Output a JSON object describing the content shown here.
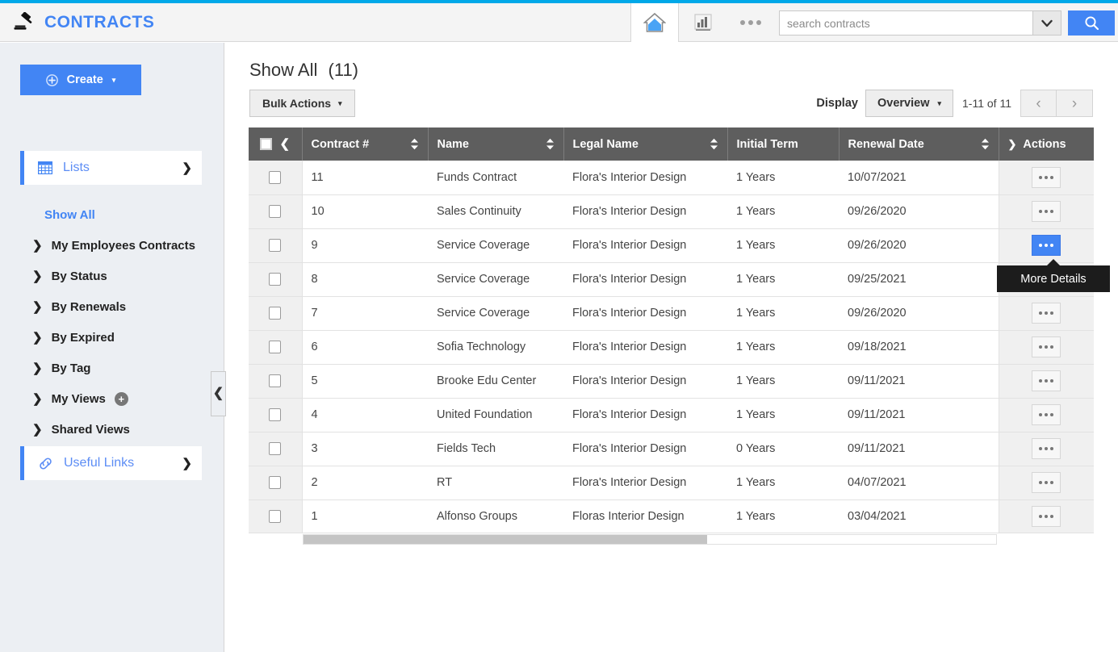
{
  "header": {
    "brand_title": "CONTRACTS",
    "brand_icon": "gavel-icon",
    "home_icon": "home-icon",
    "chart_icon": "bar-chart-icon",
    "more_icon": "ellipsis-icon",
    "search_placeholder": "search contracts",
    "search_value": "",
    "search_dropdown_icon": "chevron-down-icon",
    "search_button_icon": "search-icon"
  },
  "sidebar": {
    "create_label": "Create",
    "create_icon": "plus-circle-icon",
    "create_caret": "▾",
    "groups": [
      {
        "label": "Lists",
        "icon": "grid-icon",
        "chevron": "⌄"
      },
      {
        "label": "Useful Links",
        "icon": "link-icon",
        "chevron": "❯"
      }
    ],
    "items": [
      {
        "label": "Show All",
        "arrow": "",
        "active": true
      },
      {
        "label": "My Employees Contracts",
        "arrow": "❯",
        "active": false
      },
      {
        "label": "By Status",
        "arrow": "❯",
        "active": false
      },
      {
        "label": "By Renewals",
        "arrow": "❯",
        "active": false
      },
      {
        "label": "By Expired",
        "arrow": "❯",
        "active": false
      },
      {
        "label": "By Tag",
        "arrow": "❯",
        "active": false
      },
      {
        "label": "My Views",
        "arrow": "❯",
        "active": false,
        "add_badge": "+"
      },
      {
        "label": "Shared Views",
        "arrow": "❯",
        "active": false
      }
    ],
    "collapse_icon": "❮"
  },
  "main": {
    "title": "Show All",
    "count": "(11)",
    "bulk_actions_label": "Bulk Actions",
    "bulk_actions_caret": "▾",
    "display_label": "Display",
    "display_value": "Overview",
    "display_caret": "▾",
    "range_text": "1-11 of 11",
    "prev_icon": "‹",
    "next_icon": "›"
  },
  "table": {
    "columns": [
      {
        "key": "check",
        "label": "",
        "sortable": false
      },
      {
        "key": "number",
        "label": "Contract #",
        "sortable": true
      },
      {
        "key": "name",
        "label": "Name",
        "sortable": true
      },
      {
        "key": "legal",
        "label": "Legal Name",
        "sortable": true
      },
      {
        "key": "term",
        "label": "Initial Term",
        "sortable": false
      },
      {
        "key": "renew",
        "label": "Renewal Date",
        "sortable": true
      },
      {
        "key": "actions",
        "label": "Actions",
        "sortable": false
      }
    ],
    "header_collapse_icon": "❮",
    "actions_expand_icon": "❯",
    "row_action_icon": "ellipsis-icon",
    "rows": [
      {
        "number": "11",
        "name": "Funds Contract",
        "legal": "Flora's Interior Design",
        "term": "1 Years",
        "renew": "10/07/2021",
        "active": false
      },
      {
        "number": "10",
        "name": "Sales Continuity",
        "legal": "Flora's Interior Design",
        "term": "1 Years",
        "renew": "09/26/2020",
        "active": false
      },
      {
        "number": "9",
        "name": "Service Coverage",
        "legal": "Flora's Interior Design",
        "term": "1 Years",
        "renew": "09/26/2020",
        "active": true
      },
      {
        "number": "8",
        "name": "Service Coverage",
        "legal": "Flora's Interior Design",
        "term": "1 Years",
        "renew": "09/25/2021",
        "active": false
      },
      {
        "number": "7",
        "name": "Service Coverage",
        "legal": "Flora's Interior Design",
        "term": "1 Years",
        "renew": "09/26/2020",
        "active": false
      },
      {
        "number": "6",
        "name": "Sofia Technology",
        "legal": "Flora's Interior Design",
        "term": "1 Years",
        "renew": "09/18/2021",
        "active": false
      },
      {
        "number": "5",
        "name": "Brooke Edu Center",
        "legal": "Flora's Interior Design",
        "term": "1 Years",
        "renew": "09/11/2021",
        "active": false
      },
      {
        "number": "4",
        "name": "United Foundation",
        "legal": "Flora's Interior Design",
        "term": "1 Years",
        "renew": "09/11/2021",
        "active": false
      },
      {
        "number": "3",
        "name": "Fields Tech",
        "legal": "Flora's Interior Design",
        "term": "0 Years",
        "renew": "09/11/2021",
        "active": false
      },
      {
        "number": "2",
        "name": "RT",
        "legal": "Flora's Interior Design",
        "term": "1 Years",
        "renew": "04/07/2021",
        "active": false
      },
      {
        "number": "1",
        "name": "Alfonso Groups",
        "legal": "Floras Interior Design",
        "term": "1 Years",
        "renew": "03/04/2021",
        "active": false
      }
    ]
  },
  "tooltip": {
    "text": "More Details"
  },
  "colors": {
    "accent_blue": "#4285f4",
    "top_strip": "#00a8e8",
    "table_header": "#5e5e5e",
    "sidebar_bg": "#eceff3",
    "tooltip_bg": "#1c1c1c"
  }
}
